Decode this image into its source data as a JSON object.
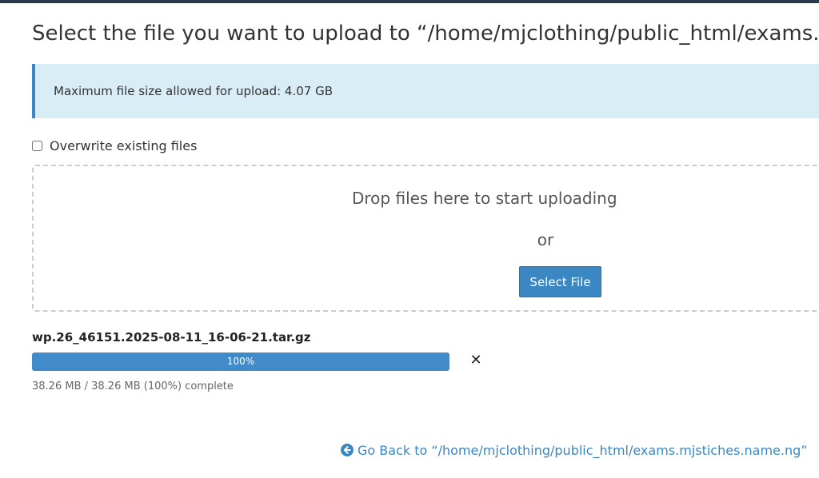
{
  "page": {
    "title": "Select the file you want to upload to “/home/mjclothing/public_html/exams.mjstiches.name.ng”"
  },
  "alert": {
    "text": "Maximum file size allowed for upload: 4.07 GB",
    "accent_color": "#3a87c4",
    "background_color": "#d9edf7"
  },
  "options": {
    "overwrite_label": "Overwrite existing files",
    "overwrite_checked": false
  },
  "dropzone": {
    "drop_text": "Drop files here to start uploading",
    "or_text": "or",
    "select_button_label": "Select File"
  },
  "upload": {
    "file_name": "wp.26_46151.2025-08-11_16-06-21.tar.gz",
    "progress_percent": 100,
    "progress_label": "100%",
    "progress_detail": "38.26 MB / 38.26 MB (100%) complete",
    "cancel_icon": "close-icon",
    "bar_color": "#428bca"
  },
  "footer": {
    "go_back_icon": "arrow-circle-left-icon",
    "go_back_label": "Go Back to “/home/mjclothing/public_html/exams.mjstiches.name.ng”",
    "link_color": "#3a87c4"
  }
}
